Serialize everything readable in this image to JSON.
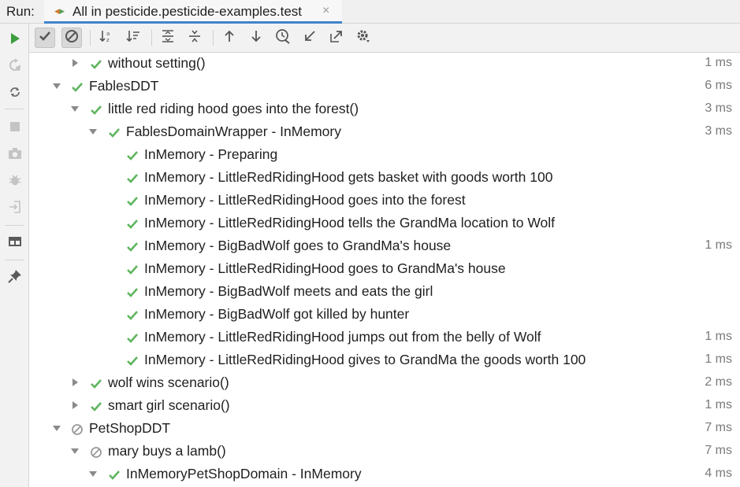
{
  "header": {
    "run_label": "Run:",
    "tab_title": "All in pesticide.pesticide-examples.test",
    "tab_close": "×"
  },
  "colors": {
    "passed": "#5fb55f",
    "ignored": "#9a9a9a",
    "accent": "#4083c9",
    "run_green": "#3d9c3d"
  },
  "sidebar": {
    "items": [
      {
        "name": "rerun-icon",
        "state": "enabled"
      },
      {
        "name": "rerun-failed-icon",
        "state": "disabled"
      },
      {
        "name": "toggle-auto-test-icon",
        "state": "enabled"
      },
      {
        "name": "stop-icon",
        "state": "disabled"
      },
      {
        "name": "camera-icon",
        "state": "disabled"
      },
      {
        "name": "debug-icon",
        "state": "disabled"
      },
      {
        "name": "export-icon",
        "state": "disabled"
      },
      {
        "name": "layout-icon",
        "state": "enabled"
      },
      {
        "name": "pin-icon",
        "state": "enabled"
      }
    ]
  },
  "toolbar": {
    "buttons": [
      {
        "name": "show-passed-button",
        "icon": "check-icon",
        "pressed": true
      },
      {
        "name": "show-ignored-button",
        "icon": "ignored-icon",
        "pressed": true
      },
      {
        "name": "sort-alphabetically-button",
        "icon": "sort-alpha-icon",
        "pressed": false
      },
      {
        "name": "sort-by-duration-button",
        "icon": "sort-duration-icon",
        "pressed": false
      },
      {
        "name": "expand-all-button",
        "icon": "expand-all-icon",
        "pressed": false
      },
      {
        "name": "collapse-all-button",
        "icon": "collapse-all-icon",
        "pressed": false
      },
      {
        "name": "previous-failed-button",
        "icon": "arrow-up-icon",
        "pressed": false
      },
      {
        "name": "next-failed-button",
        "icon": "arrow-down-icon",
        "pressed": false
      },
      {
        "name": "test-history-button",
        "icon": "history-icon",
        "pressed": false
      },
      {
        "name": "import-tests-button",
        "icon": "import-icon",
        "pressed": false
      },
      {
        "name": "export-tests-button",
        "icon": "export-icon",
        "pressed": false
      },
      {
        "name": "settings-button",
        "icon": "gear-icon",
        "pressed": false
      }
    ]
  },
  "tree": {
    "rows": [
      {
        "label": "without setting()",
        "time": "1 ms",
        "depth": 2,
        "arrow": "collapsed",
        "status": "passed"
      },
      {
        "label": "FablesDDT",
        "time": "6 ms",
        "depth": 1,
        "arrow": "expanded",
        "status": "passed"
      },
      {
        "label": "little red riding hood goes into the forest()",
        "time": "3 ms",
        "depth": 2,
        "arrow": "expanded",
        "status": "passed"
      },
      {
        "label": "FablesDomainWrapper - InMemory",
        "time": "3 ms",
        "depth": 3,
        "arrow": "expanded",
        "status": "passed"
      },
      {
        "label": "InMemory - Preparing",
        "time": "",
        "depth": 4,
        "arrow": "none",
        "status": "passed"
      },
      {
        "label": "InMemory - LittleRedRidingHood gets basket with goods worth 100",
        "time": "",
        "depth": 4,
        "arrow": "none",
        "status": "passed"
      },
      {
        "label": "InMemory - LittleRedRidingHood goes into the forest",
        "time": "",
        "depth": 4,
        "arrow": "none",
        "status": "passed"
      },
      {
        "label": "InMemory - LittleRedRidingHood tells the GrandMa location to Wolf",
        "time": "",
        "depth": 4,
        "arrow": "none",
        "status": "passed"
      },
      {
        "label": "InMemory - BigBadWolf goes to GrandMa's house",
        "time": "1 ms",
        "depth": 4,
        "arrow": "none",
        "status": "passed"
      },
      {
        "label": "InMemory - LittleRedRidingHood goes to GrandMa's house",
        "time": "",
        "depth": 4,
        "arrow": "none",
        "status": "passed"
      },
      {
        "label": "InMemory - BigBadWolf meets and eats the girl",
        "time": "",
        "depth": 4,
        "arrow": "none",
        "status": "passed"
      },
      {
        "label": "InMemory - BigBadWolf got killed by hunter",
        "time": "",
        "depth": 4,
        "arrow": "none",
        "status": "passed"
      },
      {
        "label": "InMemory - LittleRedRidingHood jumps out from the belly of Wolf",
        "time": "1 ms",
        "depth": 4,
        "arrow": "none",
        "status": "passed"
      },
      {
        "label": "InMemory - LittleRedRidingHood gives to GrandMa the goods worth 100",
        "time": "1 ms",
        "depth": 4,
        "arrow": "none",
        "status": "passed"
      },
      {
        "label": "wolf wins scenario()",
        "time": "2 ms",
        "depth": 2,
        "arrow": "collapsed",
        "status": "passed"
      },
      {
        "label": "smart girl scenario()",
        "time": "1 ms",
        "depth": 2,
        "arrow": "collapsed",
        "status": "passed"
      },
      {
        "label": "PetShopDDT",
        "time": "7 ms",
        "depth": 1,
        "arrow": "expanded",
        "status": "ignored"
      },
      {
        "label": "mary buys a lamb()",
        "time": "7 ms",
        "depth": 2,
        "arrow": "expanded",
        "status": "ignored"
      },
      {
        "label": "InMemoryPetShopDomain - InMemory",
        "time": "4 ms",
        "depth": 3,
        "arrow": "expanded",
        "status": "passed"
      }
    ]
  }
}
